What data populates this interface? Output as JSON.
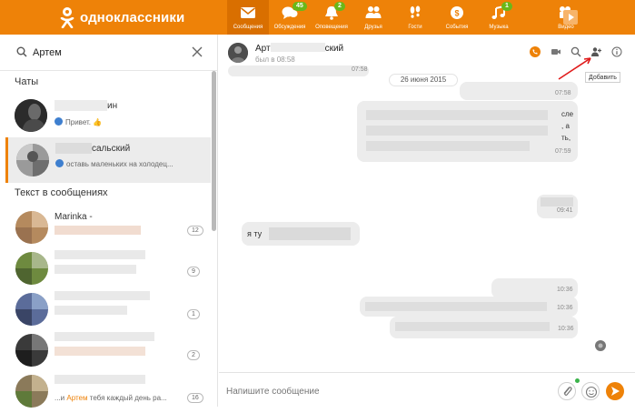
{
  "app": {
    "logo_text": "одноклассники",
    "accent_color": "#ee8208"
  },
  "nav": [
    {
      "label": "Сообщения",
      "icon": "envelope-icon",
      "badge": "",
      "active": true
    },
    {
      "label": "Обсуждения",
      "icon": "discussions-icon",
      "badge": "45",
      "active": false
    },
    {
      "label": "Оповещения",
      "icon": "bell-icon",
      "badge": "2",
      "active": false
    },
    {
      "label": "Друзья",
      "icon": "friends-icon",
      "badge": "",
      "active": false
    },
    {
      "label": "Гости",
      "icon": "footprints-icon",
      "badge": "",
      "active": false
    },
    {
      "label": "События",
      "icon": "events-icon",
      "badge": "",
      "active": false
    },
    {
      "label": "Музыка",
      "icon": "music-icon",
      "badge": "1",
      "active": false
    },
    {
      "label": "Видео",
      "icon": "video-camera-icon",
      "badge": "",
      "active": false
    }
  ],
  "search": {
    "value": "Артем",
    "icon": "search-icon"
  },
  "sections": {
    "chats": "Чаты",
    "in_messages": "Текст в сообщениях"
  },
  "chats": [
    {
      "name_suffix": "ин",
      "preview": "Привет.",
      "emoji": "👍"
    },
    {
      "name_suffix": "сальский",
      "preview": "оставь маленьких на холодец..."
    }
  ],
  "message_results": [
    {
      "name": "Marinka -",
      "count": "12"
    },
    {
      "name": "",
      "count": "9"
    },
    {
      "name": "",
      "count": "1"
    },
    {
      "name": "",
      "count": "2"
    },
    {
      "name": "",
      "preview_prefix": "...и",
      "preview_highlight": "Артем",
      "preview_rest": "тебя каждый день ра...",
      "count": "16"
    }
  ],
  "conversation": {
    "name_prefix": "Арт",
    "name_suffix": "ский",
    "last_seen": "был в 08:58",
    "tooltip": "Добавить",
    "date_separator": "26 июня 2015",
    "messages": [
      {
        "time": "07:58",
        "side": "right"
      },
      {
        "text_fragments": [
          "сле",
          ", а",
          "ть,"
        ],
        "time": "07:59",
        "side": "right"
      },
      {
        "time": "09:41",
        "side": "right"
      },
      {
        "text": "я ту",
        "side": "left"
      },
      {
        "time": "10:36",
        "side": "right"
      },
      {
        "time": "10:36",
        "side": "right"
      },
      {
        "time": "10:36",
        "side": "right"
      }
    ],
    "composer_placeholder": "Напишите сообщение"
  }
}
